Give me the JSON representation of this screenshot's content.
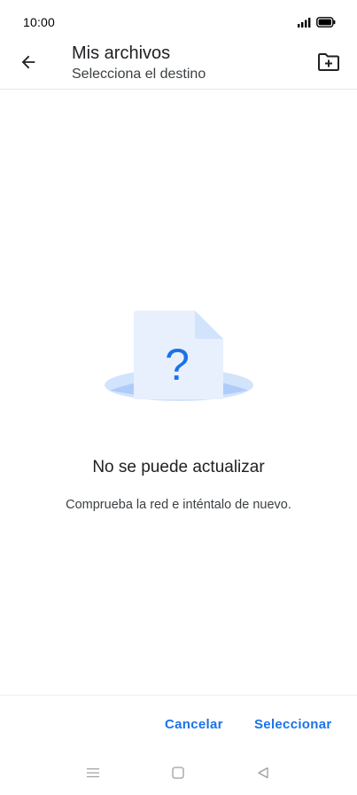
{
  "status_bar": {
    "time": "10:00",
    "icons": [
      "signal-icon",
      "battery-icon"
    ]
  },
  "app_bar": {
    "title": "Mis archivos",
    "subtitle": "Selecciona el destino",
    "back_icon": "arrow-back-icon",
    "action_icon": "new-folder-icon"
  },
  "empty_state": {
    "illustration_icon": "question-document-icon",
    "title": "No se puede actualizar",
    "message": "Comprueba la red e inténtalo de nuevo."
  },
  "actions": {
    "cancel_label": "Cancelar",
    "select_label": "Seleccionar"
  },
  "navigation": {
    "keys": [
      "menu-icon",
      "home-icon",
      "back-triangle-icon"
    ]
  },
  "colors": {
    "accent": "#1a73e8",
    "illustration_light": "#e8f0fe",
    "illustration_mid": "#d2e3fc",
    "illustration_dark": "#aecbfa"
  }
}
